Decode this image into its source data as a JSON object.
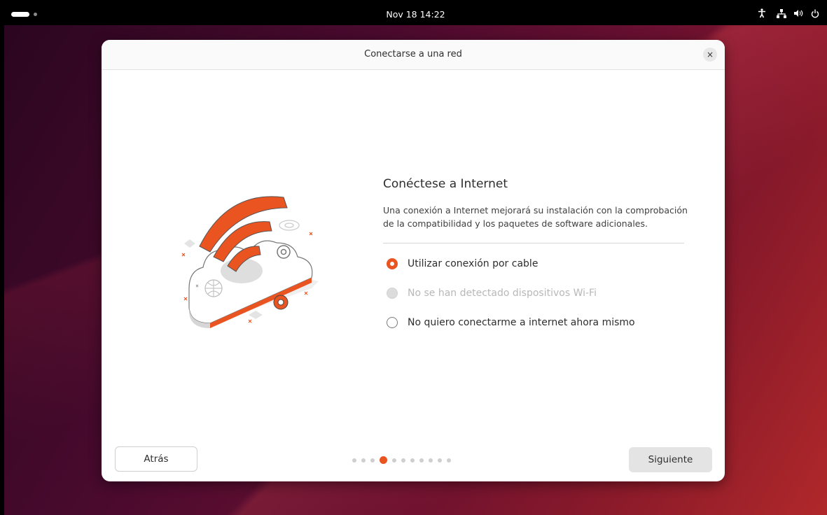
{
  "topbar": {
    "clock": "Nov 18  14:22",
    "icons": [
      "activities-pill-icon",
      "accessibility-icon",
      "network-wired-icon",
      "volume-icon",
      "power-icon"
    ]
  },
  "dialog": {
    "title": "Conectarse a una red",
    "close_label": "×",
    "heading": "Conéctese a Internet",
    "description": "Una conexión a Internet mejorará su instalación con la comprobación de la compatibilidad y los paquetes de software adicionales.",
    "options": [
      {
        "label": "Utilizar conexión por cable",
        "state": "selected"
      },
      {
        "label": "No se han detectado dispositivos Wi-Fi",
        "state": "disabled"
      },
      {
        "label": "No quiero conectarme a internet ahora mismo",
        "state": "unselected"
      }
    ],
    "back_label": "Atrás",
    "next_label": "Siguiente",
    "pager": {
      "total": 11,
      "current": 4
    }
  },
  "colors": {
    "accent": "#e95420",
    "topbar": "#000000"
  }
}
